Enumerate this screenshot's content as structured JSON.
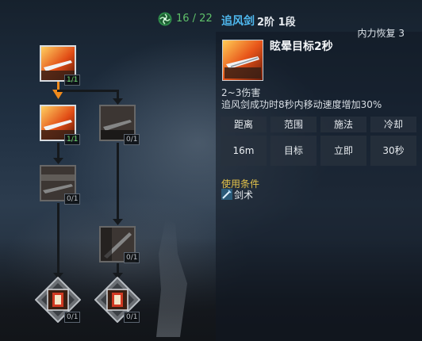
{
  "header": {
    "skill_points": "16 / 22",
    "skill_name": "追风剑",
    "skill_tier": "2阶 1段",
    "regen_text": "内力恢复 3"
  },
  "detail": {
    "effect_title": "眩晕目标2秒",
    "damage": "2~3伤害",
    "description": "追风剑成功时8秒内移动速度增加30%",
    "stats": {
      "headers": [
        "距离",
        "范围",
        "施法",
        "冷却"
      ],
      "values": [
        "16m",
        "目标",
        "立即",
        "30秒"
      ]
    },
    "condition_label": "使用条件",
    "condition_value": "剑术"
  },
  "tree": {
    "nodes": [
      {
        "id": "n1",
        "badge": "1/1",
        "active": true
      },
      {
        "id": "n2",
        "badge": "1/1",
        "active": true
      },
      {
        "id": "n3",
        "badge": "0/1",
        "active": false
      },
      {
        "id": "n4",
        "badge": "0/1",
        "active": false
      },
      {
        "id": "n5",
        "badge": "0/1",
        "active": false
      },
      {
        "id": "n6",
        "badge": "0/1",
        "active": false
      },
      {
        "id": "n7",
        "badge": "0/1",
        "active": false
      }
    ]
  },
  "colors": {
    "accent_blue": "#4fb9f0",
    "points_green": "#5fc06a",
    "condition_yellow": "#e3c34a",
    "badge_active": "#6dde6f",
    "link_arrow_orange": "#f08a1c"
  }
}
